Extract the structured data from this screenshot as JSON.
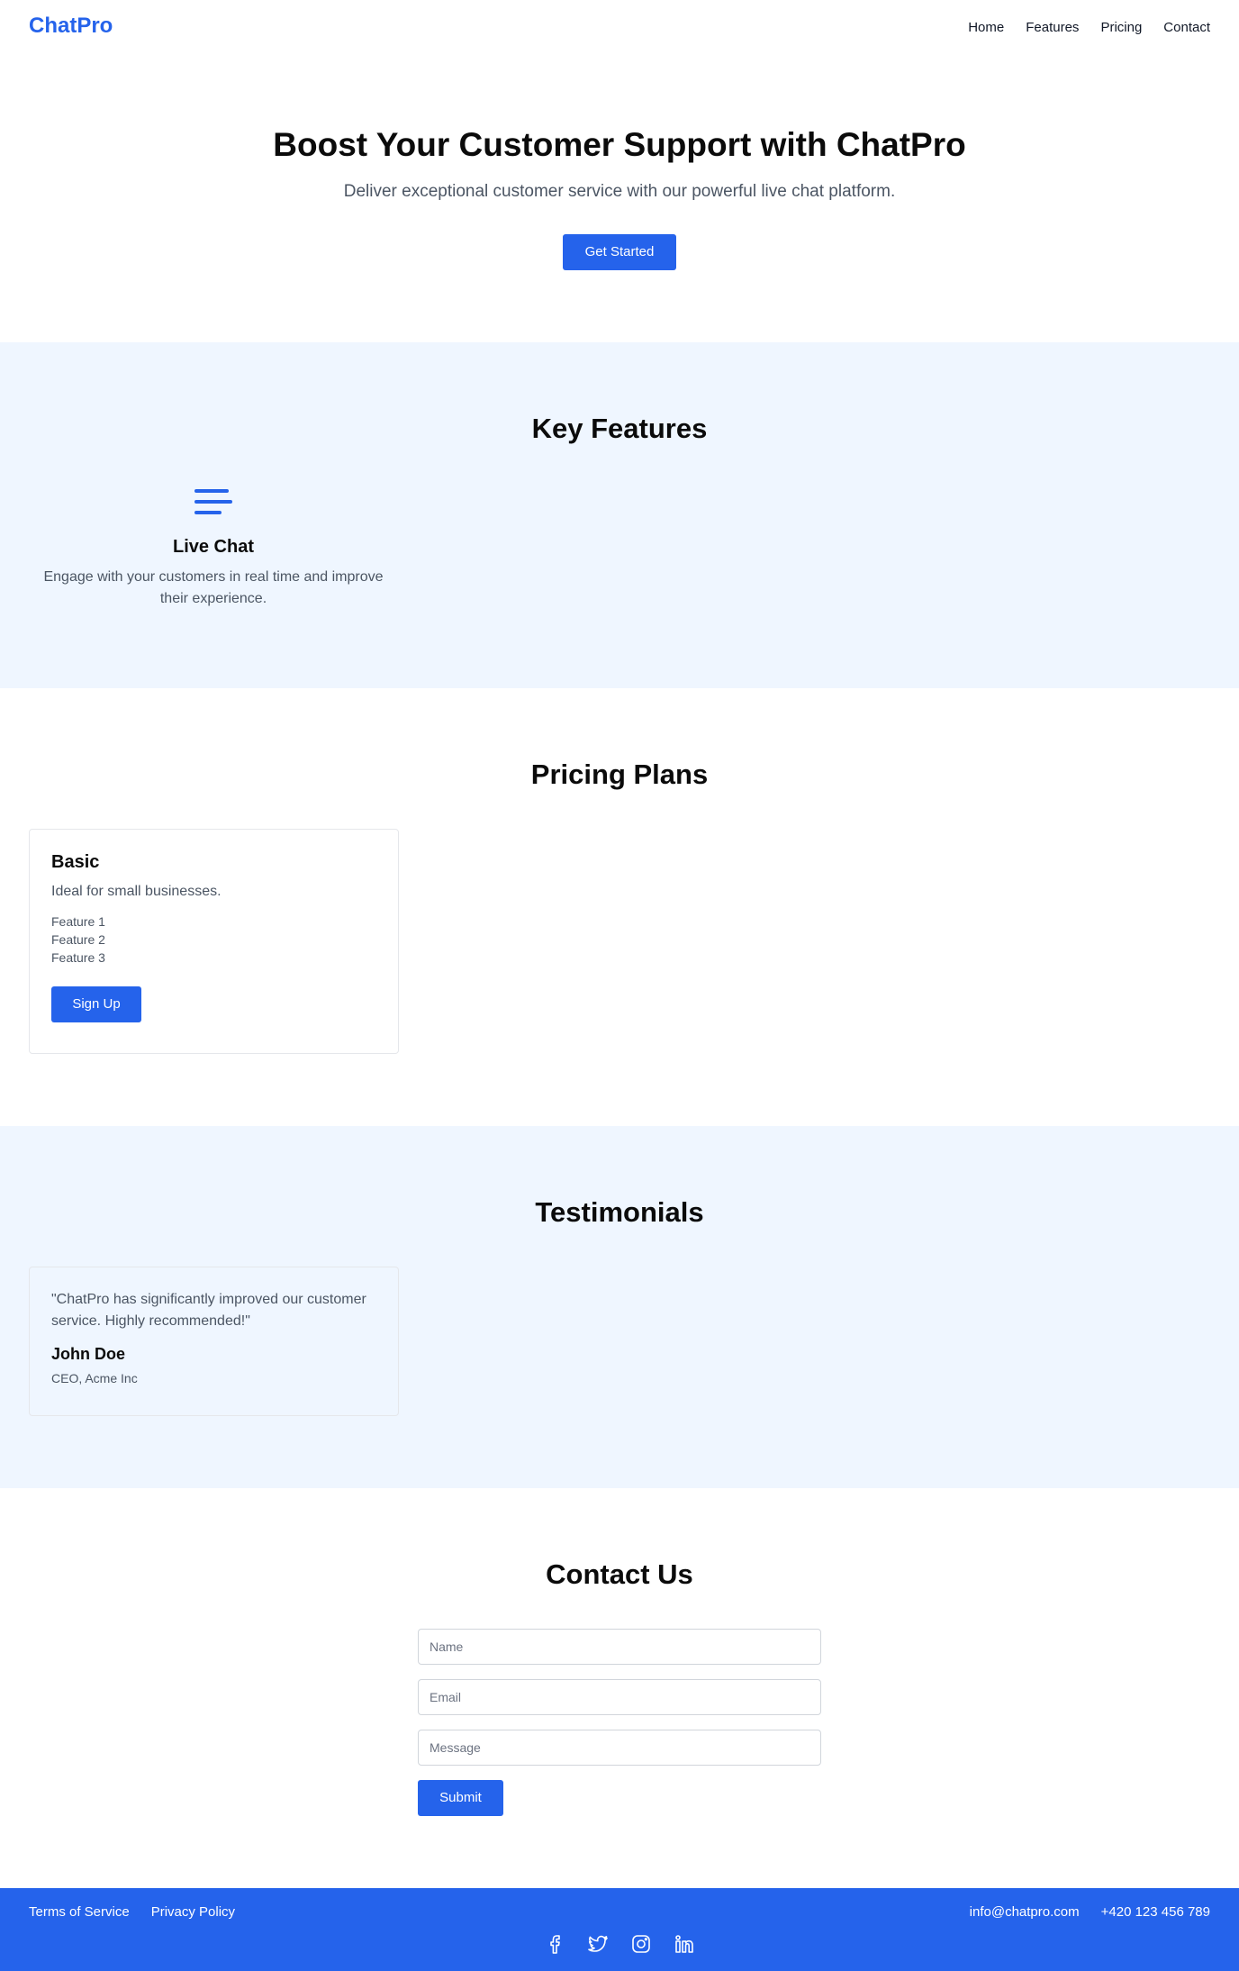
{
  "header": {
    "logo": "ChatPro",
    "nav": [
      "Home",
      "Features",
      "Pricing",
      "Contact"
    ]
  },
  "hero": {
    "title": "Boost Your Customer Support with ChatPro",
    "subtitle": "Deliver exceptional customer service with our powerful live chat platform.",
    "cta_label": "Get Started"
  },
  "features": {
    "title": "Key Features",
    "items": [
      {
        "icon": "menu-lines-icon",
        "title": "Live Chat",
        "description": "Engage with your customers in real time and improve their experience."
      }
    ]
  },
  "pricing": {
    "title": "Pricing Plans",
    "plans": [
      {
        "name": "Basic",
        "description": "Ideal for small businesses.",
        "features": [
          "Feature 1",
          "Feature 2",
          "Feature 3"
        ],
        "button_label": "Sign Up"
      }
    ]
  },
  "testimonials": {
    "title": "Testimonials",
    "items": [
      {
        "quote": "\"ChatPro has significantly improved our customer service. Highly recommended!\"",
        "author": "John Doe",
        "role": "CEO, Acme Inc"
      }
    ]
  },
  "contact": {
    "title": "Contact Us",
    "name_placeholder": "Name",
    "email_placeholder": "Email",
    "message_placeholder": "Message",
    "submit_label": "Submit"
  },
  "footer": {
    "links": [
      "Terms of Service",
      "Privacy Policy"
    ],
    "email": "info@chatpro.com",
    "phone": "+420 123 456 789",
    "social": [
      "facebook-icon",
      "twitter-icon",
      "instagram-icon",
      "linkedin-icon"
    ]
  },
  "colors": {
    "accent": "#2563eb",
    "section_bg": "#eff6ff",
    "text": "#111827",
    "muted_text": "#4b5563"
  }
}
